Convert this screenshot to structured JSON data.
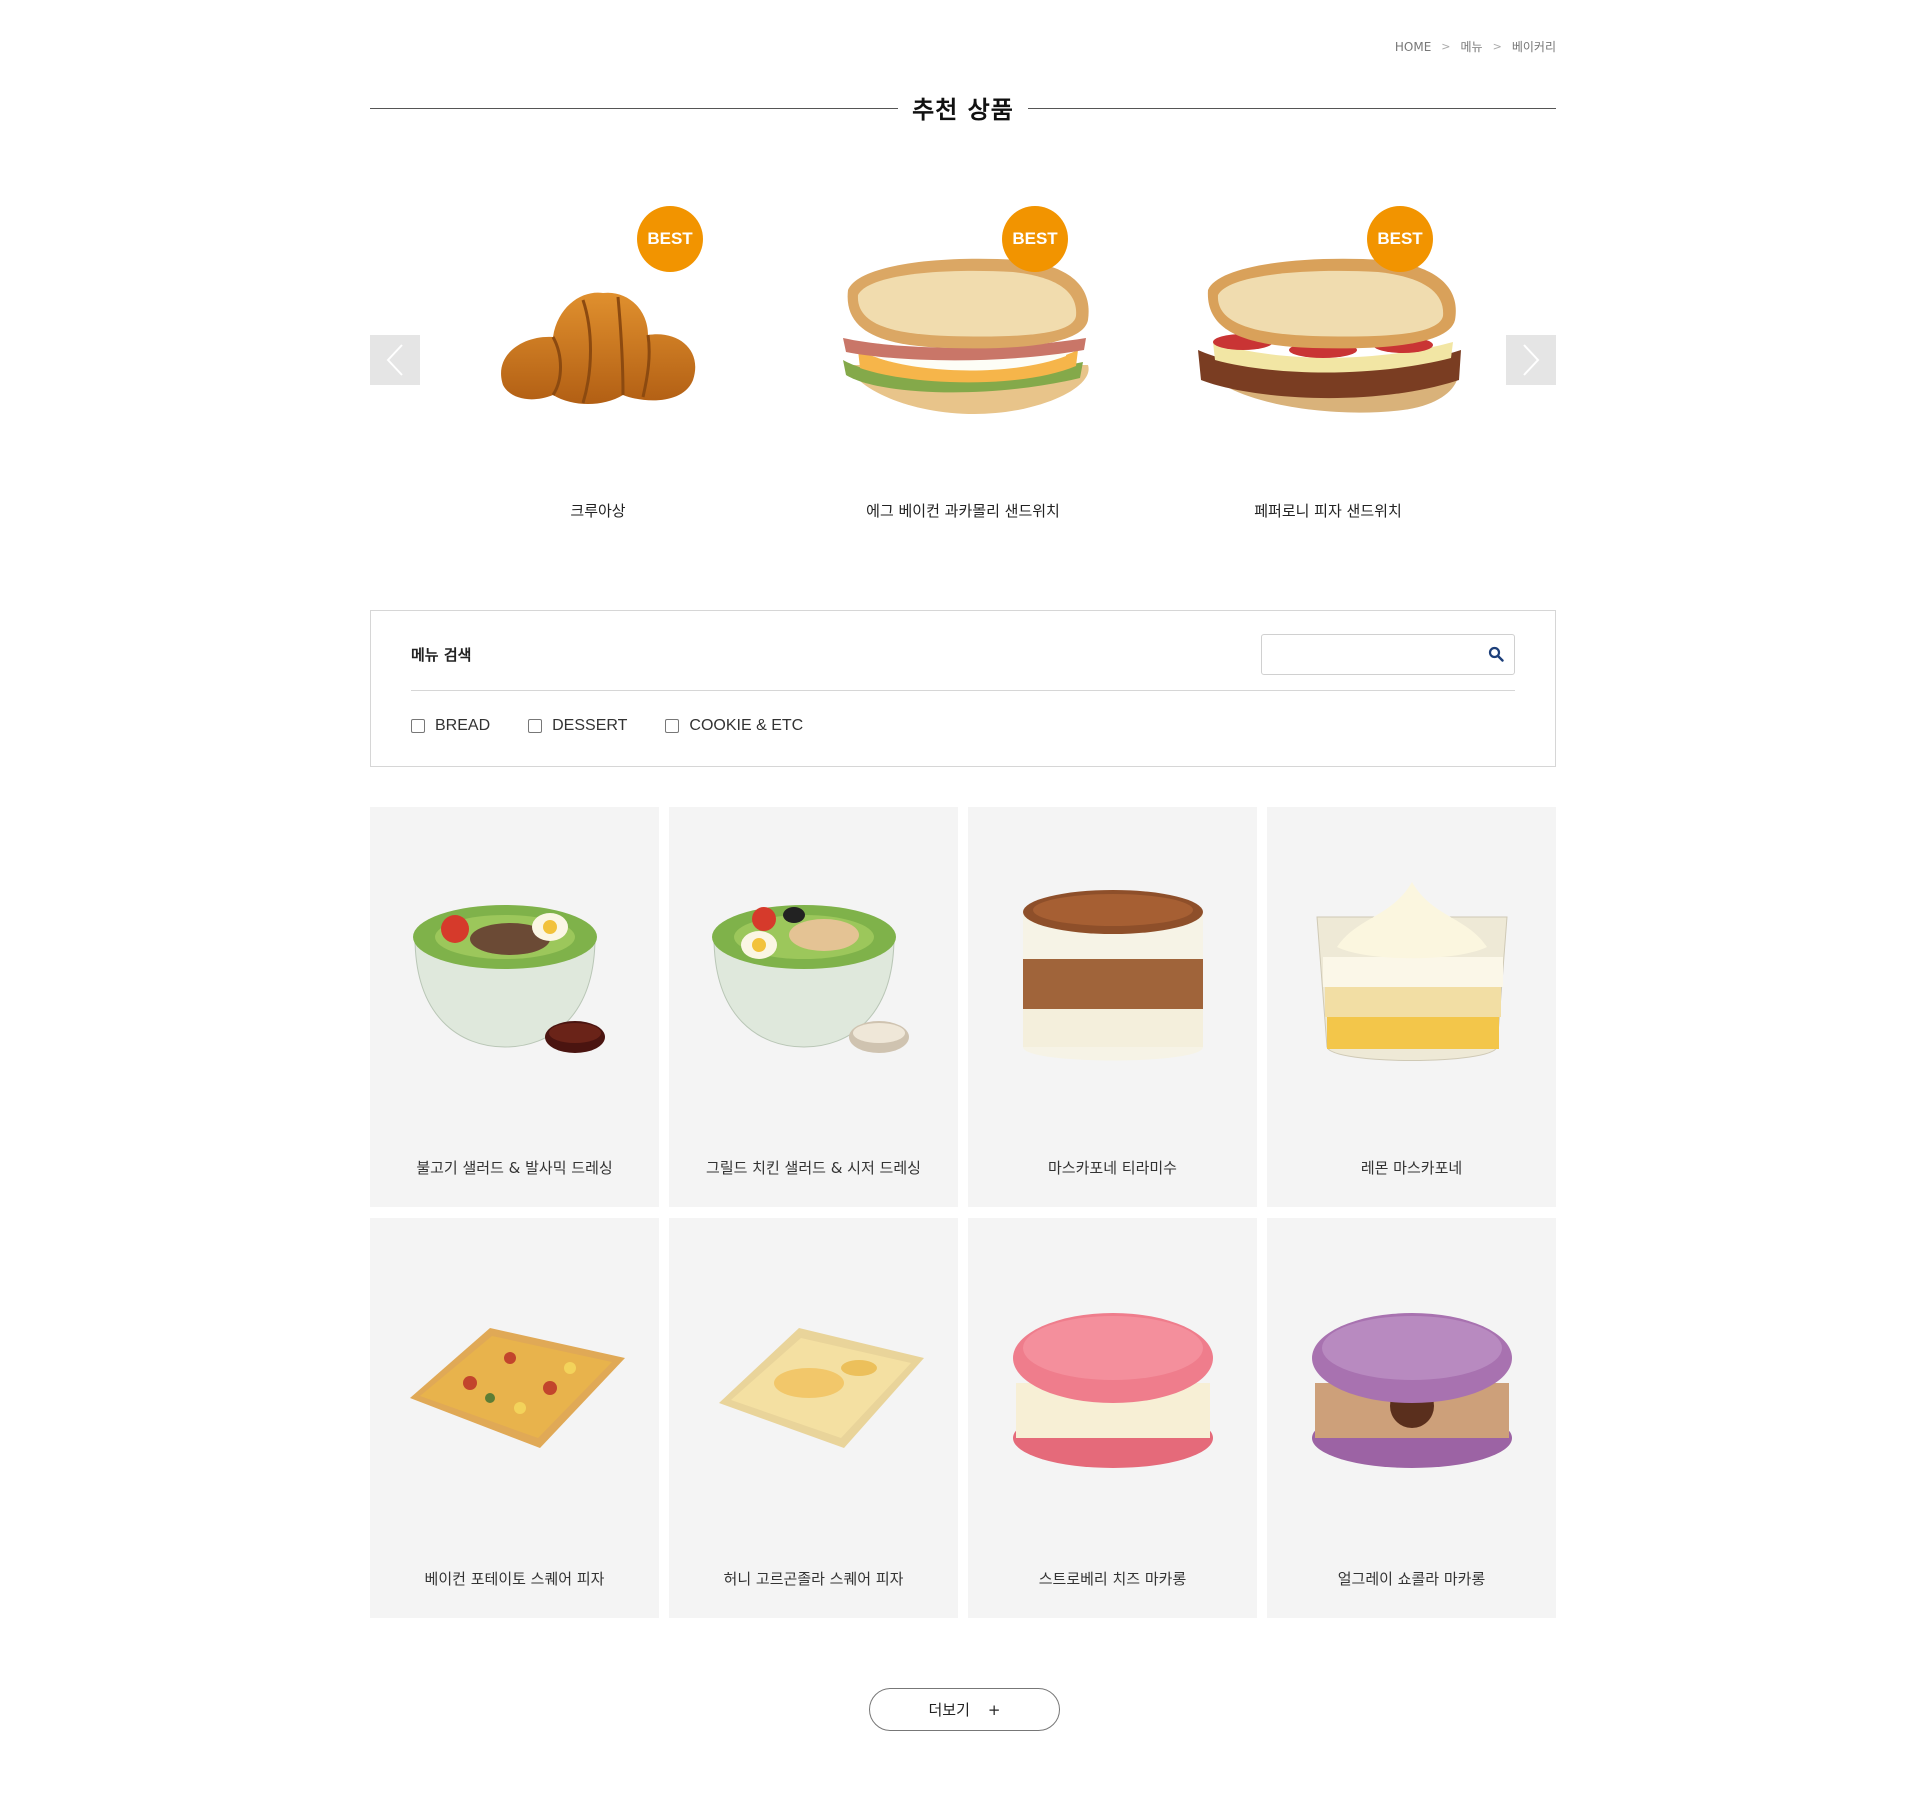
{
  "breadcrumb": {
    "home": "HOME",
    "level1": "메뉴",
    "level2": "베이커리"
  },
  "recommended": {
    "title": "추천 상품",
    "badge": "BEST",
    "items": [
      {
        "name": "크루아상",
        "image": "croissant"
      },
      {
        "name": "에그 베이컨 과카몰리 샌드위치",
        "image": "egg-bacon-guacamole-sandwich"
      },
      {
        "name": "페퍼로니 피자 샌드위치",
        "image": "pepperoni-pizza-sandwich"
      }
    ]
  },
  "search": {
    "title": "메뉴 검색",
    "value": "",
    "placeholder": "",
    "filters": [
      {
        "label": "BREAD",
        "checked": false
      },
      {
        "label": "DESSERT",
        "checked": false
      },
      {
        "label": "COOKIE & ETC",
        "checked": false
      }
    ]
  },
  "products": [
    {
      "name": "불고기 샐러드 & 발사믹 드레싱"
    },
    {
      "name": "그릴드 치킨 샐러드 & 시저 드레싱"
    },
    {
      "name": "마스카포네 티라미수"
    },
    {
      "name": "레몬 마스카포네"
    },
    {
      "name": "베이컨 포테이토 스퀘어 피자"
    },
    {
      "name": "허니 고르곤졸라 스퀘어 피자"
    },
    {
      "name": "스트로베리 치즈 마카롱"
    },
    {
      "name": "얼그레이 쇼콜라 마카롱"
    }
  ],
  "more": {
    "label": "더보기",
    "icon": "+"
  },
  "colors": {
    "accent": "#f29400",
    "card_bg": "#f4f4f4",
    "arrow_bg": "#e5e5e5"
  }
}
